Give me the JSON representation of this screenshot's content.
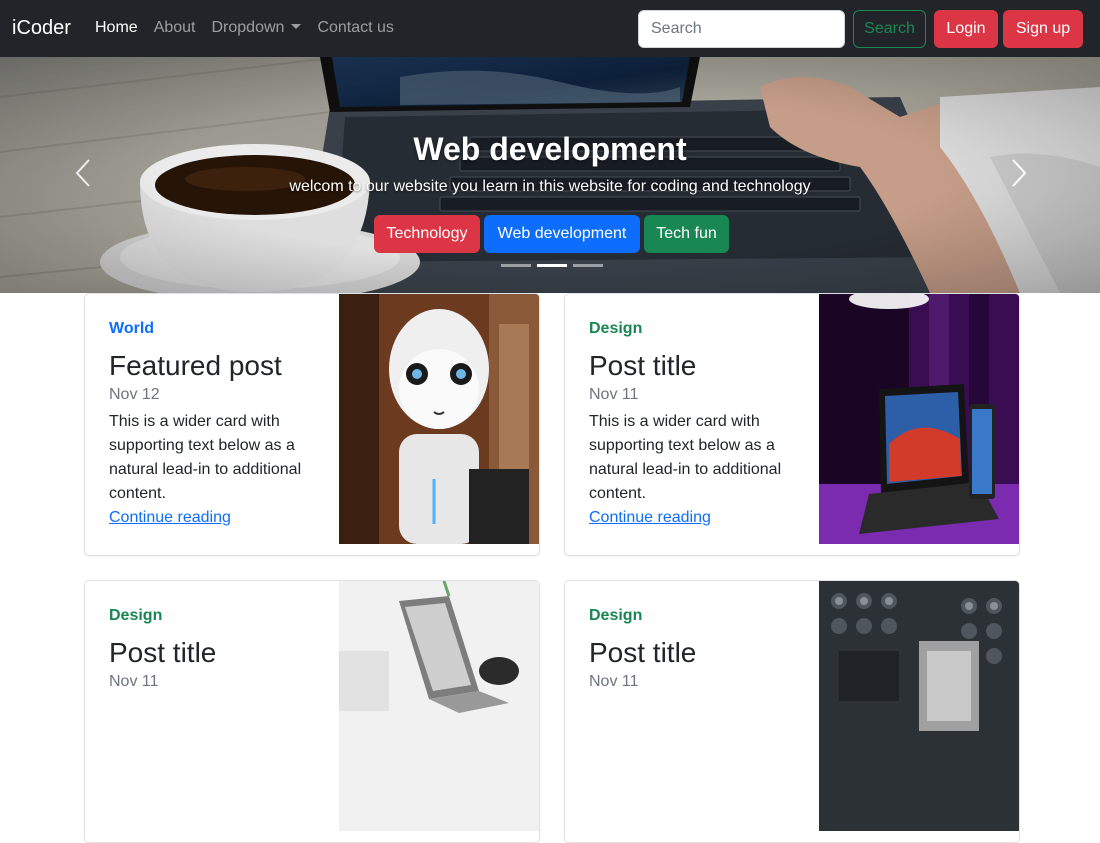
{
  "navbar": {
    "brand": "iCoder",
    "links": [
      "Home",
      "About",
      "Dropdown",
      "Contact us"
    ],
    "search_placeholder": "Search",
    "search_button": "Search",
    "login_button": "Login",
    "signup_button": "Sign up"
  },
  "hero": {
    "title": "Web development",
    "subtitle": "welcom to our website you learn in this website for coding and technology",
    "buttons": [
      "Technology",
      "Web development",
      "Tech fun"
    ],
    "active_slide": 2,
    "slide_count": 3
  },
  "cards": [
    {
      "category": "World",
      "title": "Featured post",
      "date": "Nov 12",
      "text": "This is a wider card with supporting text below as a natural lead-in to additional content.",
      "link": "Continue reading"
    },
    {
      "category": "Design",
      "title": "Post title",
      "date": "Nov 11",
      "text": "This is a wider card with supporting text below as a natural lead-in to additional content.",
      "link": "Continue reading"
    },
    {
      "category": "Design",
      "title": "Post title",
      "date": "Nov 11",
      "text": "",
      "link": ""
    },
    {
      "category": "Design",
      "title": "Post title",
      "date": "Nov 11",
      "text": "",
      "link": ""
    }
  ],
  "colors": {
    "navbar_bg": "#212529",
    "primary": "#0d6efd",
    "success": "#198754",
    "danger": "#dc3545"
  }
}
